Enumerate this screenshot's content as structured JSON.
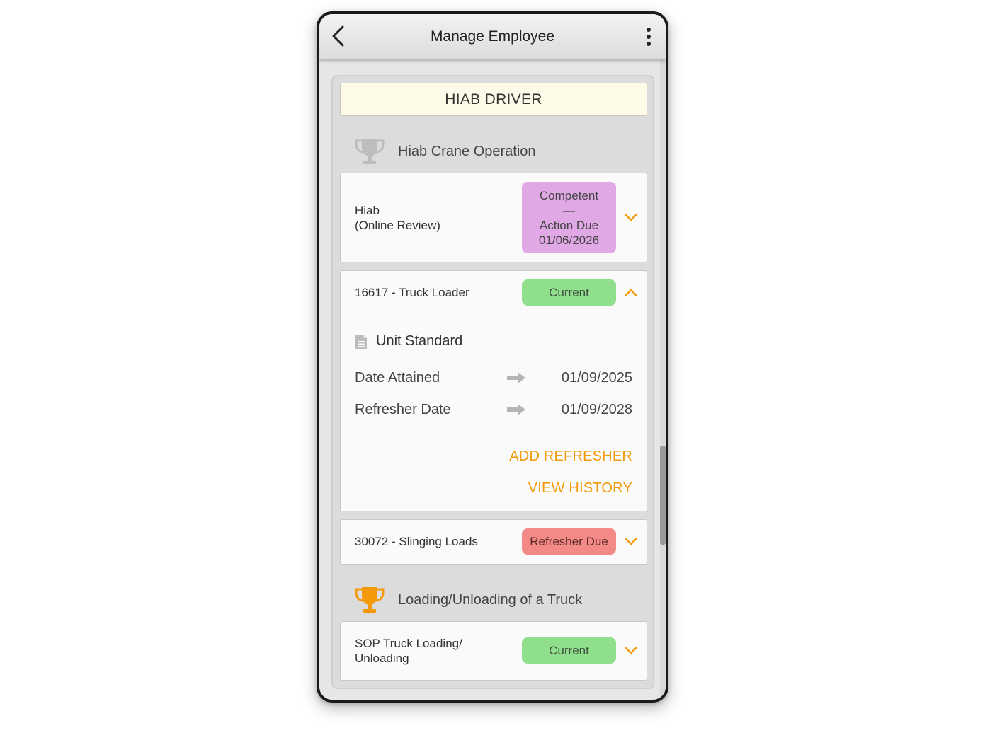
{
  "appbar": {
    "title": "Manage Employee"
  },
  "role": {
    "title": "HIAB DRIVER"
  },
  "sections": [
    {
      "title": "Hiab Crane Operation",
      "trophy_color": "#bdbdbd"
    },
    {
      "title": "Loading/Unloading of a Truck",
      "trophy_color": "#f49a0a"
    }
  ],
  "cards": {
    "hiab": {
      "name_line1": "Hiab",
      "name_line2": "(Online Review)",
      "badge_line1": "Competent",
      "badge_line2": "—",
      "badge_line3": "Action Due",
      "badge_line4": "01/06/2026",
      "badge_color": "#e0a8e4",
      "expanded": false
    },
    "truck_loader": {
      "name": "16617 - Truck Loader",
      "badge": "Current",
      "badge_color": "#8fdf8c",
      "expanded": true,
      "detail": {
        "type_label": "Unit Standard",
        "date_attained_label": "Date Attained",
        "date_attained_value": "01/09/2025",
        "refresher_date_label": "Refresher Date",
        "refresher_date_value": "01/09/2028",
        "add_refresher": "ADD REFRESHER",
        "view_history": "VIEW HISTORY"
      }
    },
    "slinging": {
      "name": "30072 - Slinging Loads",
      "badge": "Refresher Due",
      "badge_color": "#f48a88",
      "expanded": false
    },
    "sop": {
      "name_line1": "SOP Truck Loading/",
      "name_line2": "Unloading",
      "badge": "Current",
      "badge_color": "#8fdf8c",
      "expanded": false
    }
  },
  "colors": {
    "accent": "#f49a0a"
  }
}
